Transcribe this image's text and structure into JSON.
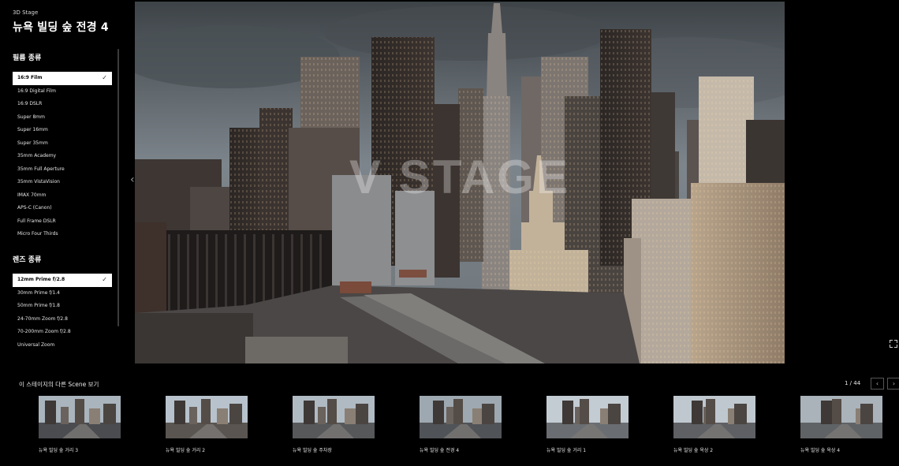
{
  "header": {
    "stage_label": "3D Stage",
    "scene_title": "뉴욕 빌딩 숲 전경 4"
  },
  "film": {
    "title": "필름 종류",
    "items": [
      {
        "label": "16:9 Film",
        "selected": true
      },
      {
        "label": "16:9 Digital Film",
        "selected": false
      },
      {
        "label": "16:9 DSLR",
        "selected": false
      },
      {
        "label": "Super 8mm",
        "selected": false
      },
      {
        "label": "Super 16mm",
        "selected": false
      },
      {
        "label": "Super 35mm",
        "selected": false
      },
      {
        "label": "35mm Academy",
        "selected": false
      },
      {
        "label": "35mm Full Aperture",
        "selected": false
      },
      {
        "label": "35mm VistaVision",
        "selected": false
      },
      {
        "label": "IMAX 70mm",
        "selected": false
      },
      {
        "label": "APS-C (Canon)",
        "selected": false
      },
      {
        "label": "Full Frame DSLR",
        "selected": false
      },
      {
        "label": "Micro Four Thirds",
        "selected": false
      }
    ]
  },
  "lens": {
    "title": "렌즈 종류",
    "items": [
      {
        "label": "12mm Prime f/2.8",
        "selected": true
      },
      {
        "label": "30mm Prime f/1.4",
        "selected": false
      },
      {
        "label": "50mm Prime f/1.8",
        "selected": false
      },
      {
        "label": "24-70mm Zoom f/2.8",
        "selected": false
      },
      {
        "label": "70-200mm Zoom f/2.8",
        "selected": false
      },
      {
        "label": "Universal Zoom",
        "selected": false
      }
    ]
  },
  "viewer": {
    "watermark": "V STAGE",
    "prev_glyph": "‹",
    "check_glyph": "✓"
  },
  "other_scenes": {
    "title": "이 스테이지의 다른 Scene 보기",
    "pager": "1 / 44",
    "prev_glyph": "‹",
    "next_glyph": "›",
    "thumbs": [
      {
        "label": "뉴욕 빌딩 숲 거리 3",
        "sky": "#a9b4bd",
        "ground": "#4a4c50"
      },
      {
        "label": "뉴욕 빌딩 숲 거리 2",
        "sky": "#b7c2cc",
        "ground": "#5a5550"
      },
      {
        "label": "뉴욕 빌딩 숲 주차장",
        "sky": "#b0bac3",
        "ground": "#56585a"
      },
      {
        "label": "뉴욕 빌딩 숲 전경 4",
        "sky": "#9ea8b0",
        "ground": "#505357"
      },
      {
        "label": "뉴욕 빌딩 숲 거리 1",
        "sky": "#c3ccd3",
        "ground": "#6a6e72"
      },
      {
        "label": "뉴욕 빌딩 숲 옥상 2",
        "sky": "#bfc8cf",
        "ground": "#5e6064"
      },
      {
        "label": "뉴욕 빌딩 숲 옥상 4",
        "sky": "#aab3ba",
        "ground": "#606366"
      }
    ]
  }
}
